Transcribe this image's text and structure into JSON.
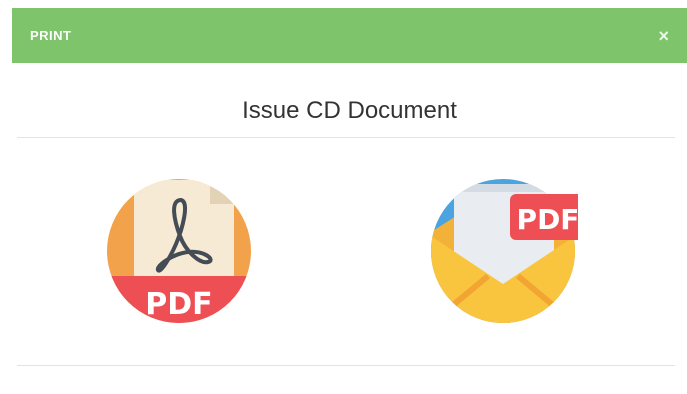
{
  "dialog": {
    "title": "PRINT",
    "close_symbol": "×",
    "heading": "Issue CD Document"
  },
  "actions": [
    {
      "name": "pdf-download",
      "icon": "pdf-document-icon",
      "badge": "PDF"
    },
    {
      "name": "email-pdf",
      "icon": "email-pdf-icon",
      "badge": "PDF"
    }
  ],
  "colors": {
    "header_bg": "#7dc46a",
    "pdf_red": "#ee4f55",
    "envelope_yellow": "#f9c53f",
    "orange_circle": "#f1a24a",
    "blue_circle": "#4ba3e0"
  }
}
